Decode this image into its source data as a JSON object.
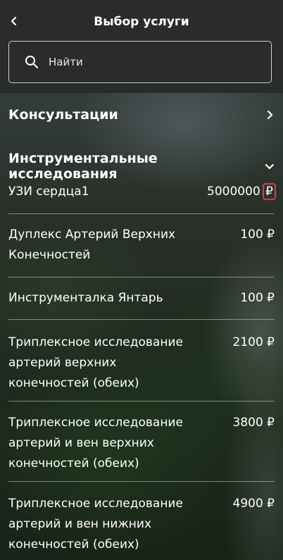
{
  "header": {
    "title": "Выбор услуги",
    "back_icon": "chevron-left-icon"
  },
  "search": {
    "placeholder": "Найти",
    "icon": "search-icon"
  },
  "sections": [
    {
      "label": "Консультации",
      "icon": "chevron-right-icon"
    },
    {
      "label": "Инструментальные исследования",
      "icon": "chevron-down-icon"
    }
  ],
  "items": [
    {
      "name": "УЗИ сердца1",
      "amount": "5000000",
      "currency": "₽"
    },
    {
      "name": "Дуплекс Артерий Верхних Конечностей",
      "price": "100 ₽"
    },
    {
      "name": "Инструменталка Янтарь",
      "price": "100 ₽"
    },
    {
      "name": "Триплексное исследование артерий верхних конечностей (обеих)",
      "price": "2100 ₽"
    },
    {
      "name": "Триплексное исследование артерий и вен верхних конечностей (обеих)",
      "price": "3800 ₽"
    },
    {
      "name": "Триплексное исследование артерий и вен нижних конечностей (обеих)",
      "price": "4900 ₽"
    }
  ],
  "colors": {
    "header_bg": "#2a2c2c",
    "highlight": "#e33b3b",
    "text": "#ffffff"
  }
}
